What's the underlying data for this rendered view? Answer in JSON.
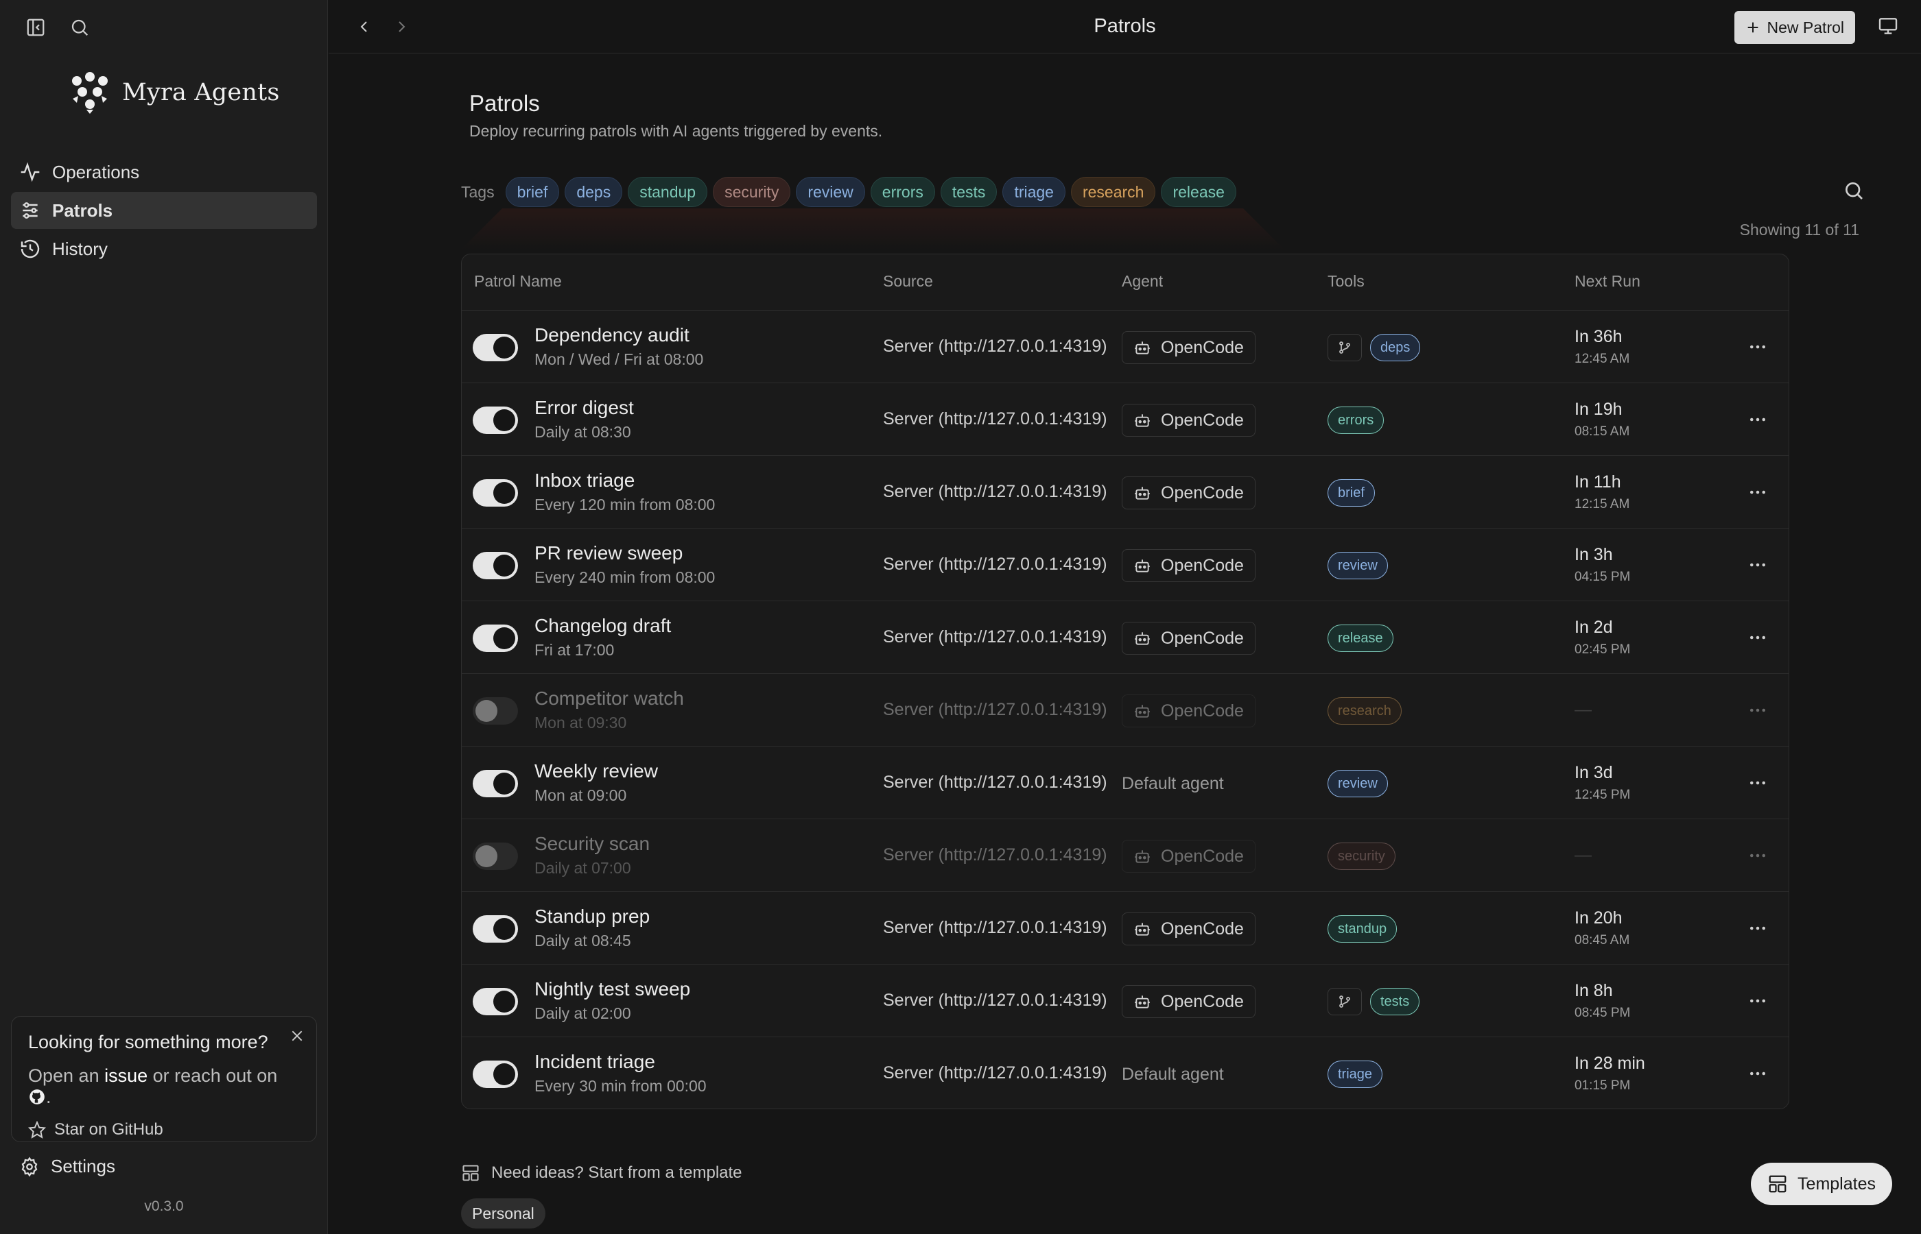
{
  "app": {
    "name": "Myra Agents",
    "version": "v0.3.0"
  },
  "sidebar": {
    "nav": [
      {
        "label": "Operations",
        "icon": "activity-icon"
      },
      {
        "label": "Patrols",
        "icon": "sliders-icon",
        "active": true
      },
      {
        "label": "History",
        "icon": "history-icon"
      }
    ],
    "promo": {
      "title": "Looking for something more?",
      "text_prefix": "Open an",
      "issue_link": "issue",
      "text_mid": "or reach out on",
      "text_suffix": ".",
      "star_label": "Star on GitHub"
    },
    "settings_label": "Settings"
  },
  "topbar": {
    "title": "Patrols",
    "new_patrol_label": "New Patrol"
  },
  "header": {
    "title": "Patrols",
    "subtitle": "Deploy recurring patrols with AI agents triggered by events."
  },
  "tags": {
    "label": "Tags",
    "items": [
      {
        "label": "brief",
        "color": "blue"
      },
      {
        "label": "deps",
        "color": "blue"
      },
      {
        "label": "standup",
        "color": "teal"
      },
      {
        "label": "security",
        "color": "red"
      },
      {
        "label": "review",
        "color": "blue"
      },
      {
        "label": "errors",
        "color": "teal"
      },
      {
        "label": "tests",
        "color": "teal"
      },
      {
        "label": "triage",
        "color": "blue"
      },
      {
        "label": "research",
        "color": "amber"
      },
      {
        "label": "release",
        "color": "teal"
      }
    ]
  },
  "showing": "Showing 11 of 11",
  "table": {
    "columns": [
      "Patrol Name",
      "Source",
      "Agent",
      "Tools",
      "Next Run"
    ],
    "rows": [
      {
        "name": "Dependency audit",
        "schedule": "Mon / Wed / Fri at 08:00",
        "source": "Server (http://127.0.0.1:4319)",
        "agent": "OpenCode",
        "agent_default": false,
        "git": true,
        "tag": "deps",
        "tag_color": "blue",
        "next": "In 36h",
        "next_time": "12:45 AM",
        "enabled": true
      },
      {
        "name": "Error digest",
        "schedule": "Daily at 08:30",
        "source": "Server (http://127.0.0.1:4319)",
        "agent": "OpenCode",
        "agent_default": false,
        "git": false,
        "tag": "errors",
        "tag_color": "teal",
        "next": "In 19h",
        "next_time": "08:15 AM",
        "enabled": true
      },
      {
        "name": "Inbox triage",
        "schedule": "Every 120 min from 08:00",
        "source": "Server (http://127.0.0.1:4319)",
        "agent": "OpenCode",
        "agent_default": false,
        "git": false,
        "tag": "brief",
        "tag_color": "blue",
        "next": "In 11h",
        "next_time": "12:15 AM",
        "enabled": true
      },
      {
        "name": "PR review sweep",
        "schedule": "Every 240 min from 08:00",
        "source": "Server (http://127.0.0.1:4319)",
        "agent": "OpenCode",
        "agent_default": false,
        "git": false,
        "tag": "review",
        "tag_color": "blue",
        "next": "In 3h",
        "next_time": "04:15 PM",
        "enabled": true
      },
      {
        "name": "Changelog draft",
        "schedule": "Fri at 17:00",
        "source": "Server (http://127.0.0.1:4319)",
        "agent": "OpenCode",
        "agent_default": false,
        "git": false,
        "tag": "release",
        "tag_color": "teal",
        "next": "In 2d",
        "next_time": "02:45 PM",
        "enabled": true
      },
      {
        "name": "Competitor watch",
        "schedule": "Mon at 09:30",
        "source": "Server (http://127.0.0.1:4319)",
        "agent": "OpenCode",
        "agent_default": false,
        "git": false,
        "tag": "research",
        "tag_color": "amber",
        "next": "—",
        "next_time": "",
        "enabled": false
      },
      {
        "name": "Weekly review",
        "schedule": "Mon at 09:00",
        "source": "Server (http://127.0.0.1:4319)",
        "agent": "Default agent",
        "agent_default": true,
        "git": false,
        "tag": "review",
        "tag_color": "blue",
        "next": "In 3d",
        "next_time": "12:45 PM",
        "enabled": true
      },
      {
        "name": "Security scan",
        "schedule": "Daily at 07:00",
        "source": "Server (http://127.0.0.1:4319)",
        "agent": "OpenCode",
        "agent_default": false,
        "git": false,
        "tag": "security",
        "tag_color": "red",
        "next": "—",
        "next_time": "",
        "enabled": false
      },
      {
        "name": "Standup prep",
        "schedule": "Daily at 08:45",
        "source": "Server (http://127.0.0.1:4319)",
        "agent": "OpenCode",
        "agent_default": false,
        "git": false,
        "tag": "standup",
        "tag_color": "teal",
        "next": "In 20h",
        "next_time": "08:45 AM",
        "enabled": true
      },
      {
        "name": "Nightly test sweep",
        "schedule": "Daily at 02:00",
        "source": "Server (http://127.0.0.1:4319)",
        "agent": "OpenCode",
        "agent_default": false,
        "git": true,
        "tag": "tests",
        "tag_color": "teal",
        "next": "In 8h",
        "next_time": "08:45 PM",
        "enabled": true
      },
      {
        "name": "Incident triage",
        "schedule": "Every 30 min from 00:00",
        "source": "Server (http://127.0.0.1:4319)",
        "agent": "Default agent",
        "agent_default": true,
        "git": false,
        "tag": "triage",
        "tag_color": "blue",
        "next": "In 28 min",
        "next_time": "01:15 PM",
        "enabled": true
      }
    ]
  },
  "footer": {
    "ideas_label": "Need ideas? Start from a template",
    "personal_label": "Personal",
    "templates_label": "Templates"
  }
}
